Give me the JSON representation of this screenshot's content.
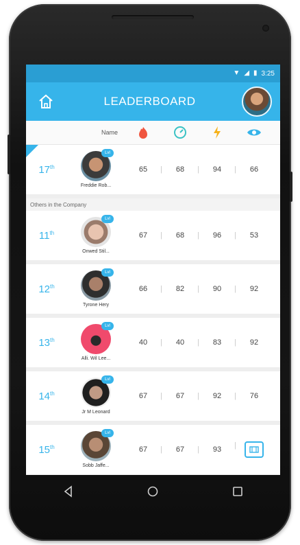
{
  "status": {
    "time": "3:25"
  },
  "header": {
    "title": "LEADERBOARD"
  },
  "columns": {
    "name_label": "Name",
    "icons": [
      "fire-hand-icon",
      "gauge-icon",
      "lightning-icon",
      "eye-icon"
    ]
  },
  "me": {
    "rank": "17",
    "rank_suffix": "th",
    "name": "Freddie Rob...",
    "badge": "Lvl",
    "scores": [
      "65",
      "68",
      "94",
      "66"
    ]
  },
  "section_label": "Others in the Company",
  "others": [
    {
      "rank": "11",
      "rank_suffix": "th",
      "name": "Onwed Stil...",
      "badge": "Lvl",
      "scores": [
        "67",
        "68",
        "96",
        "53"
      ]
    },
    {
      "rank": "12",
      "rank_suffix": "th",
      "name": "Tyrone Hery",
      "badge": "Lvl",
      "scores": [
        "66",
        "82",
        "90",
        "92"
      ]
    },
    {
      "rank": "13",
      "rank_suffix": "th",
      "name": "Alli. Wil Lee...",
      "badge": "Lvl",
      "scores": [
        "40",
        "40",
        "83",
        "92"
      ]
    },
    {
      "rank": "14",
      "rank_suffix": "th",
      "name": "Jr M Leonard",
      "badge": "Lvl",
      "scores": [
        "67",
        "67",
        "92",
        "76"
      ]
    },
    {
      "rank": "15",
      "rank_suffix": "th",
      "name": "Sobb Jaffe...",
      "badge": "Lvl",
      "scores": [
        "67",
        "67",
        "93"
      ]
    }
  ],
  "colors": {
    "accent": "#36b4ea",
    "status_bar": "#2a9ed3"
  },
  "nav": {
    "icons": [
      "back-icon",
      "home-icon",
      "recents-icon"
    ]
  }
}
